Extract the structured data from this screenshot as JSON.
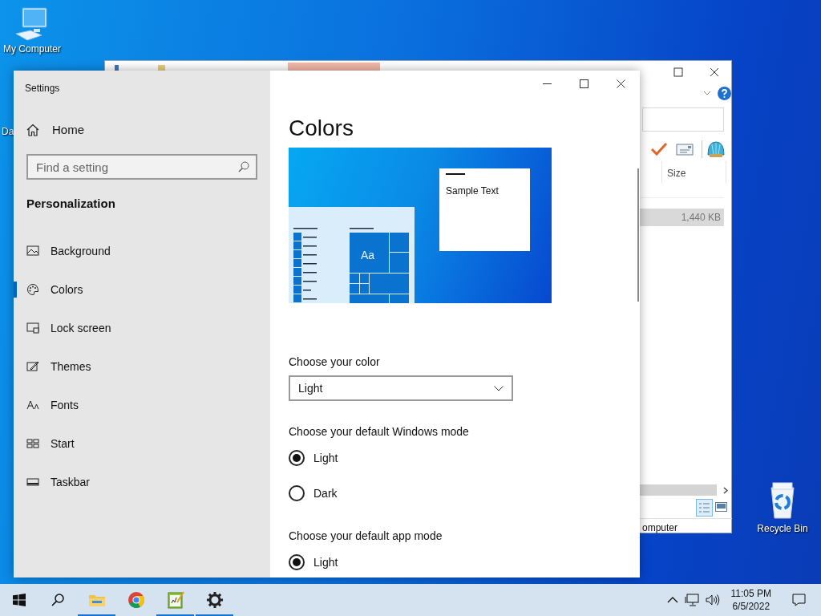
{
  "desktop_icons": [
    {
      "label": "My Computer"
    },
    {
      "label": "Da"
    },
    {
      "label": "Recycle Bin"
    }
  ],
  "explorer": {
    "column_header": "Size",
    "row_size": "1,440 KB",
    "status_text": "omputer"
  },
  "settings": {
    "title": "Settings",
    "home": "Home",
    "search": {
      "placeholder": "Find a setting"
    },
    "section": "Personalization",
    "nav": [
      {
        "label": "Background",
        "selected": false
      },
      {
        "label": "Colors",
        "selected": true
      },
      {
        "label": "Lock screen",
        "selected": false
      },
      {
        "label": "Themes",
        "selected": false
      },
      {
        "label": "Fonts",
        "selected": false
      },
      {
        "label": "Start",
        "selected": false
      },
      {
        "label": "Taskbar",
        "selected": false
      }
    ],
    "page_title": "Colors",
    "preview": {
      "sample_text": "Sample Text",
      "tile_label": "Aa"
    },
    "color_label": "Choose your color",
    "color_value": "Light",
    "groups": [
      {
        "label": "Choose your default Windows mode",
        "options": [
          {
            "label": "Light",
            "selected": true
          },
          {
            "label": "Dark",
            "selected": false
          }
        ]
      },
      {
        "label": "Choose your default app mode",
        "options": [
          {
            "label": "Light",
            "selected": true
          }
        ]
      }
    ]
  },
  "taskbar": {
    "apps": [
      {
        "kind": "folder",
        "open": true
      },
      {
        "kind": "browser",
        "open": false
      },
      {
        "kind": "notepad",
        "open": true
      },
      {
        "kind": "settings",
        "open": true
      }
    ],
    "time": "11:05 PM",
    "date": "6/5/2022"
  }
}
